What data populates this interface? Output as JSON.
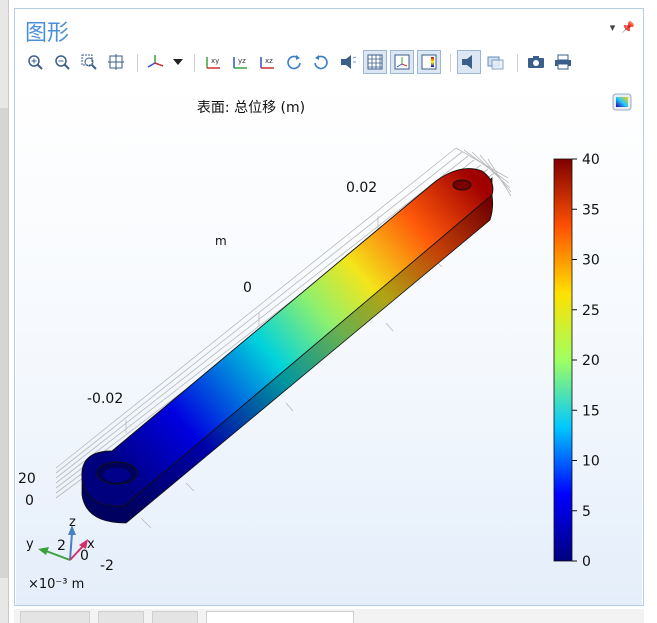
{
  "panel": {
    "title": "图形"
  },
  "plot": {
    "title": "表面: 总位移 (m)",
    "axis_unit_label": "m",
    "axis_ticks": [
      "0.02",
      "0",
      "-0.02",
      "20",
      "0",
      "2",
      "0",
      "-2"
    ],
    "scale_label": "×10⁻³ m",
    "triad": {
      "x": "x",
      "y": "y",
      "z": "z"
    }
  },
  "colorbar": {
    "ticks": [
      "40",
      "35",
      "30",
      "25",
      "20",
      "15",
      "10",
      "5",
      "0"
    ],
    "min": 0,
    "max": 40,
    "colors": [
      "#00007f",
      "#0000ff",
      "#00c8ff",
      "#a0ff60",
      "#ffe000",
      "#ff5000",
      "#7f0000"
    ]
  },
  "toolbar": {
    "icons": [
      "zoom-in-icon",
      "zoom-out-icon",
      "zoom-box-icon",
      "zoom-extents-icon",
      "go-to-default-view-icon",
      "dropdown-arrow-icon",
      "xy-view-icon",
      "yz-view-icon",
      "xz-view-icon",
      "rotate-cw-icon",
      "rotate-ccw-icon",
      "headlight-icon",
      "grid-icon",
      "axis-orientation-icon",
      "legend-icon",
      "lights-icon",
      "transparency-icon",
      "camera-icon",
      "print-icon"
    ]
  }
}
